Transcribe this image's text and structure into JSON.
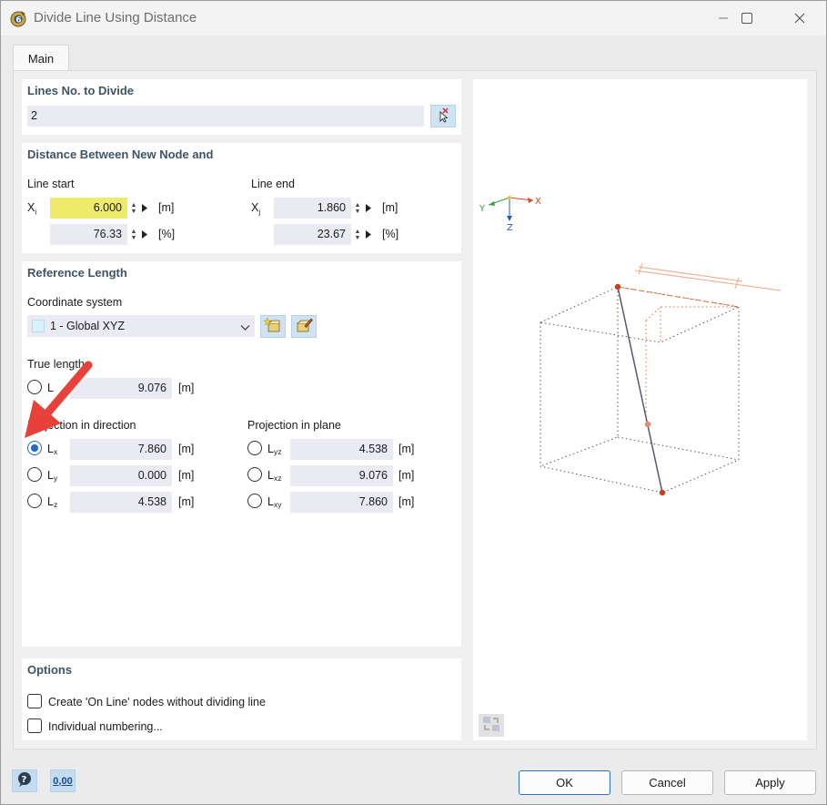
{
  "window": {
    "title": "Divide Line Using Distance",
    "tab_main": "Main"
  },
  "lines_panel": {
    "header": "Lines No. to Divide",
    "value": "2"
  },
  "distance_panel": {
    "header": "Distance Between New Node and",
    "line_start": "Line start",
    "line_end": "Line end",
    "xi_label": "Xi",
    "xj_label": "Xj",
    "xi_value": "6.000",
    "xi_unit": "[m]",
    "xi_pct_value": "76.33",
    "xi_pct_unit": "[%]",
    "xj_value": "1.860",
    "xj_unit": "[m]",
    "xj_pct_value": "23.67",
    "xj_pct_unit": "[%]"
  },
  "reference_panel": {
    "header": "Reference Length",
    "coord_label": "Coordinate system",
    "coord_value": "1 - Global XYZ",
    "true_length_label": "True length",
    "L_label": "L",
    "L_value": "9.076",
    "L_unit": "[m]",
    "proj_dir_label": "Projection in direction",
    "proj_plane_label": "Projection in plane",
    "directions": [
      {
        "label": "L",
        "sub": "x",
        "value": "7.860",
        "unit": "[m]",
        "checked": true
      },
      {
        "label": "L",
        "sub": "y",
        "value": "0.000",
        "unit": "[m]",
        "checked": false
      },
      {
        "label": "L",
        "sub": "z",
        "value": "4.538",
        "unit": "[m]",
        "checked": false
      }
    ],
    "planes": [
      {
        "label": "L",
        "sub": "yz",
        "value": "4.538",
        "unit": "[m]",
        "checked": false
      },
      {
        "label": "L",
        "sub": "xz",
        "value": "9.076",
        "unit": "[m]",
        "checked": false
      },
      {
        "label": "L",
        "sub": "xy",
        "value": "7.860",
        "unit": "[m]",
        "checked": false
      }
    ]
  },
  "options_panel": {
    "header": "Options",
    "opt1": "Create 'On Line' nodes without dividing line",
    "opt2": "Individual numbering..."
  },
  "preview": {
    "axis_x": "X",
    "axis_y": "Y",
    "axis_z": "Z"
  },
  "footer": {
    "ok": "OK",
    "cancel": "Cancel",
    "apply": "Apply",
    "units_icon_text": "0,00"
  },
  "colors": {
    "accent": "#2468c8",
    "highlight_field": "#eeeb6b",
    "annotation_arrow": "#e8413a",
    "header_text": "#3e5466"
  }
}
